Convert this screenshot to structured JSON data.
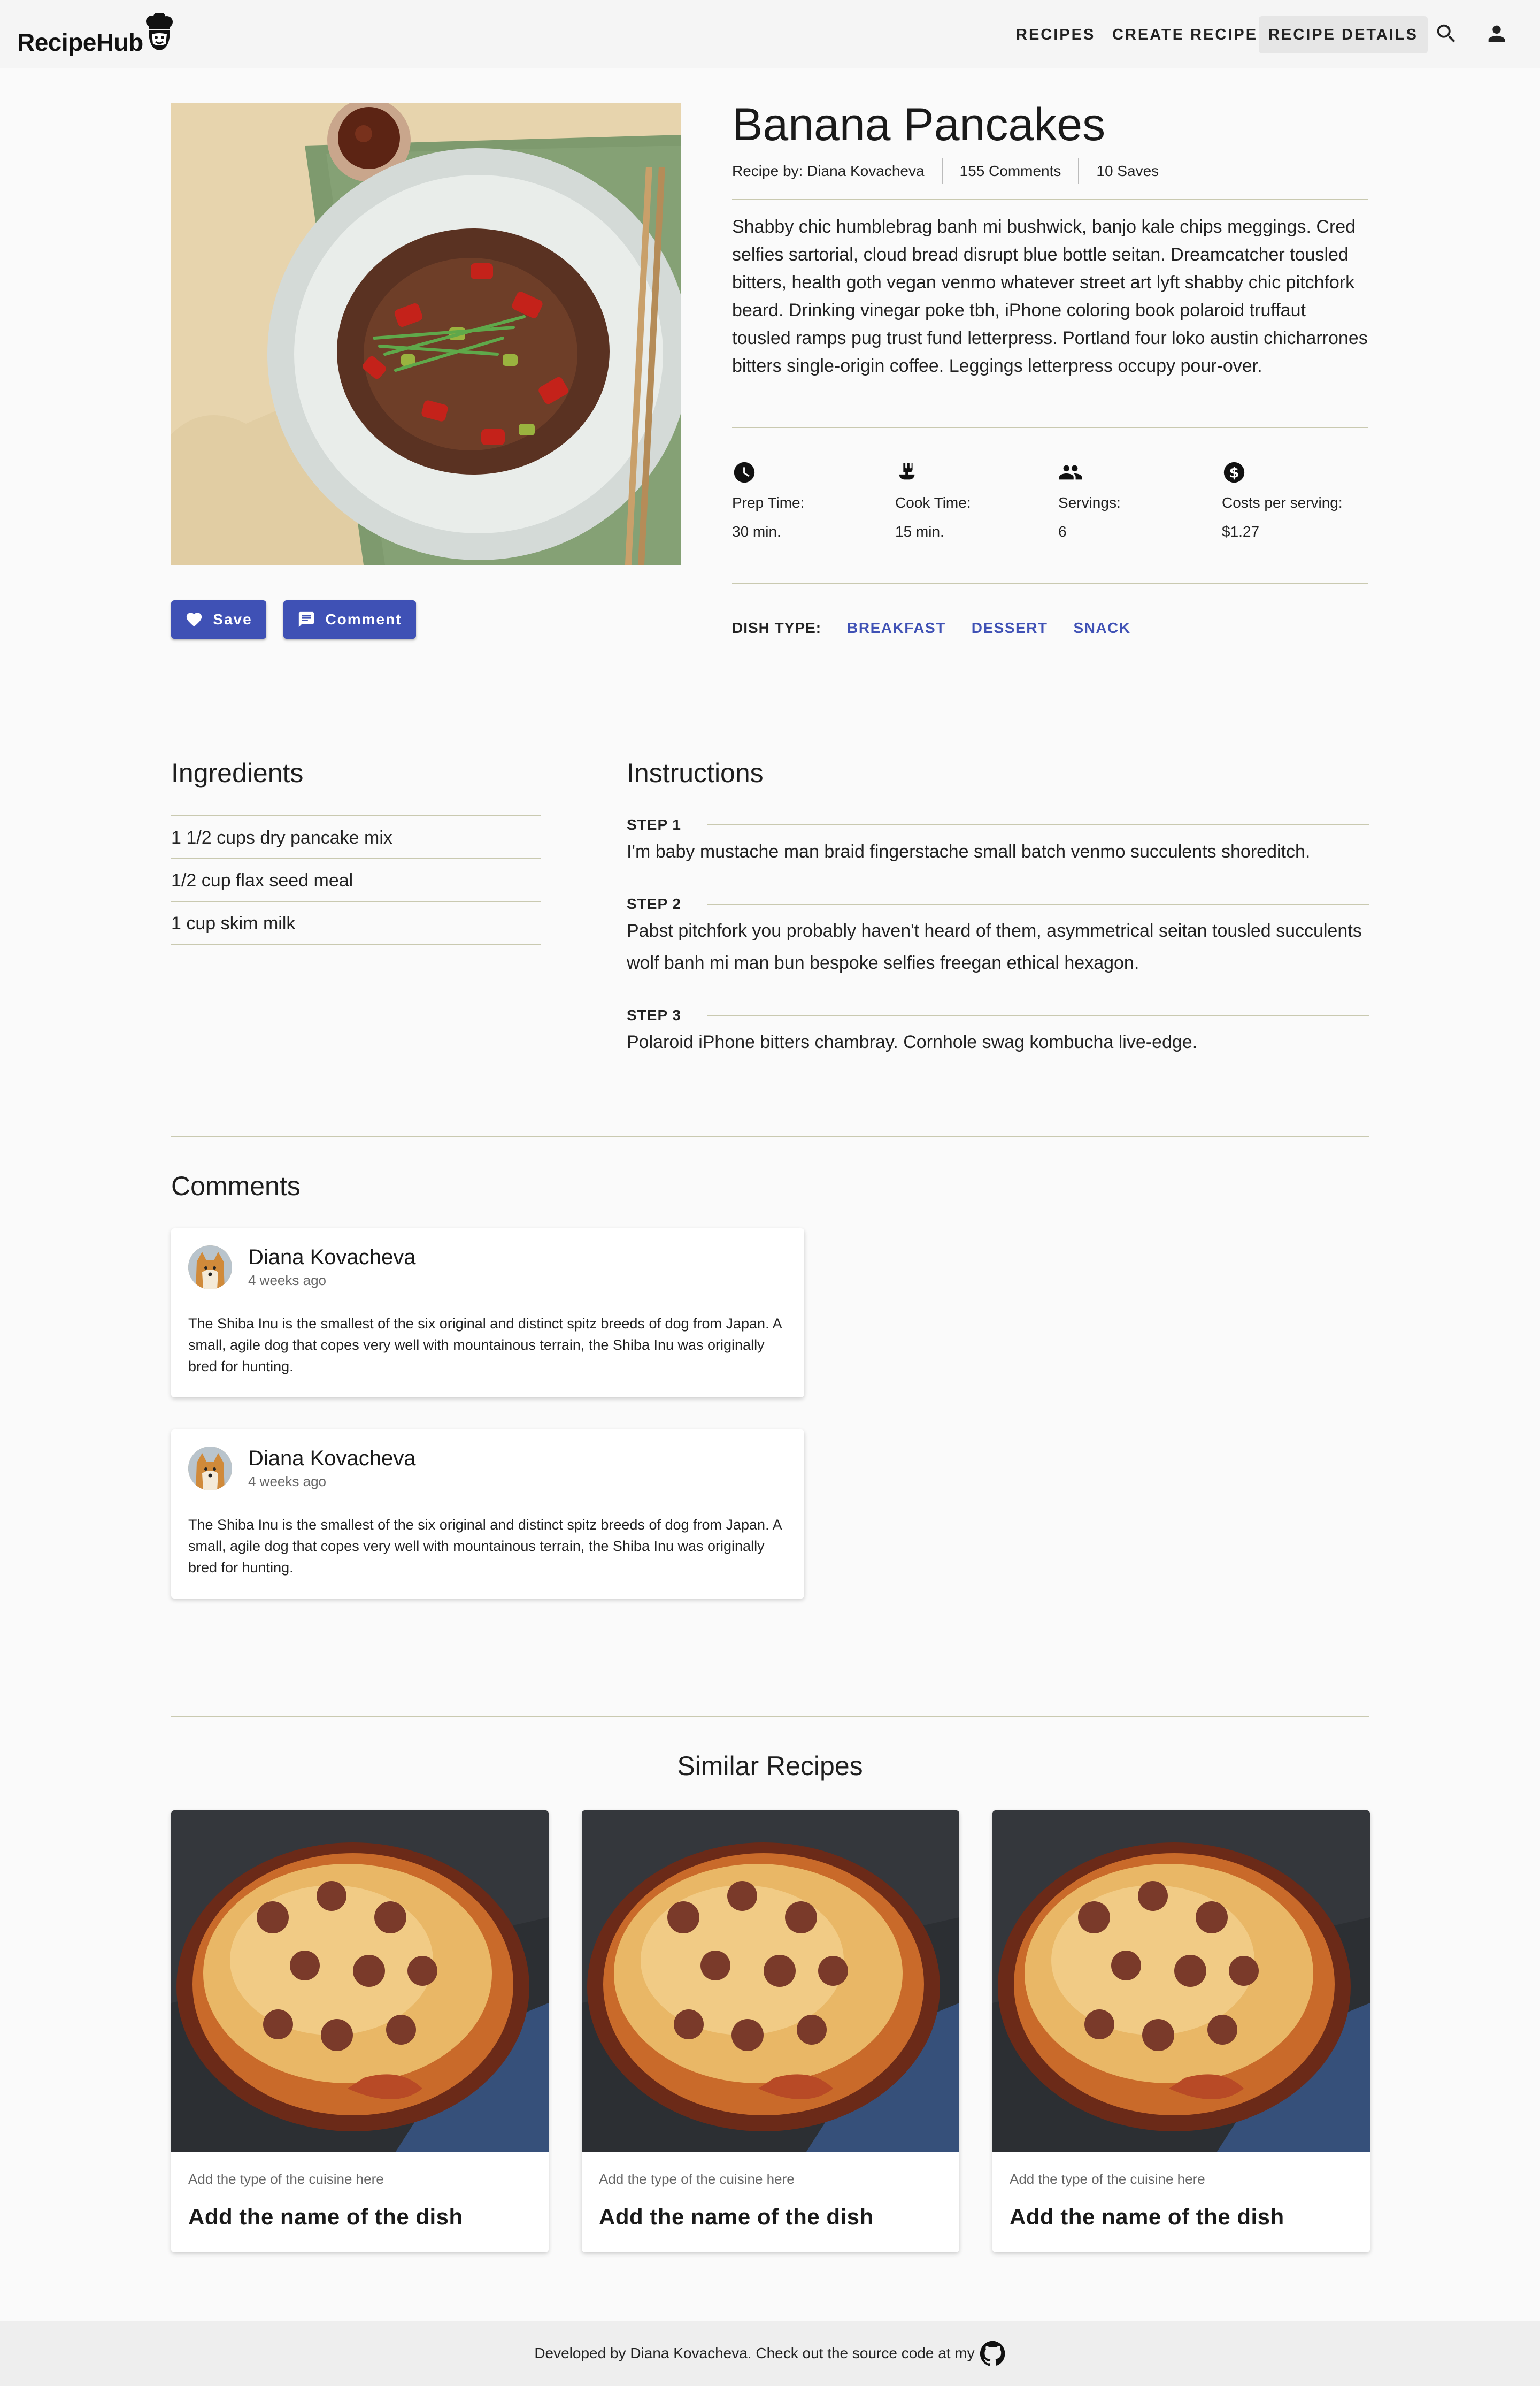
{
  "app": {
    "name": "RecipeHub"
  },
  "nav": {
    "items": [
      {
        "label": "RECIPES"
      },
      {
        "label": "CREATE RECIPE"
      },
      {
        "label": "RECIPE DETAILS"
      }
    ]
  },
  "recipe": {
    "title": "Banana Pancakes",
    "author": "Recipe by: Diana Kovacheva",
    "comments_count": "155 Comments",
    "saves": "10 Saves",
    "description": "Shabby chic humblebrag banh mi bushwick, banjo kale chips meggings. Cred selfies sartorial, cloud bread disrupt blue bottle seitan. Dreamcatcher tousled bitters, health goth vegan venmo whatever street art lyft shabby chic pitchfork beard. Drinking vinegar poke tbh, iPhone coloring book polaroid truffaut tousled ramps pug trust fund letterpress. Portland four loko austin chicharrones bitters single-origin coffee. Leggings letterpress occupy pour-over.",
    "stats": [
      {
        "icon": "clock-icon",
        "label": "Prep Time:",
        "value": "30 min."
      },
      {
        "icon": "ladle-icon",
        "label": "Cook Time:",
        "value": "15 min."
      },
      {
        "icon": "people-icon",
        "label": "Servings:",
        "value": "6"
      },
      {
        "icon": "dollar-icon",
        "label": "Costs per serving:",
        "value": "$1.27"
      }
    ],
    "dish_type_label": "DISH TYPE:",
    "dish_types": [
      "BREAKFAST",
      "DESSERT",
      "SNACK"
    ]
  },
  "actions": {
    "save": "Save",
    "comment": "Comment"
  },
  "ingredients": {
    "heading": "Ingredients",
    "items": [
      "1 1/2 cups dry pancake mix",
      "1/2 cup flax seed meal",
      "1 cup skim milk"
    ]
  },
  "instructions": {
    "heading": "Instructions",
    "steps": [
      {
        "label": "STEP 1",
        "text": "I'm baby mustache man braid fingerstache small batch venmo succulents shoreditch."
      },
      {
        "label": "STEP 2",
        "text": "Pabst pitchfork you probably haven't heard of them, asymmetrical seitan tousled succulents wolf banh mi man bun bespoke selfies freegan ethical hexagon."
      },
      {
        "label": "STEP 3",
        "text": "Polaroid iPhone bitters chambray. Cornhole swag kombucha live-edge."
      }
    ]
  },
  "comments": {
    "heading": "Comments",
    "items": [
      {
        "name": "Diana Kovacheva",
        "time": "4 weeks ago",
        "text": "The Shiba Inu is the smallest of the six original and distinct spitz breeds of dog from Japan. A small, agile dog that copes very well with mountainous terrain, the Shiba Inu was originally bred for hunting."
      },
      {
        "name": "Diana Kovacheva",
        "time": "4 weeks ago",
        "text": "The Shiba Inu is the smallest of the six original and distinct spitz breeds of dog from Japan. A small, agile dog that copes very well with mountainous terrain, the Shiba Inu was originally bred for hunting."
      }
    ]
  },
  "similar": {
    "heading": "Similar Recipes",
    "items": [
      {
        "cuisine": "Add the type of the cuisine here",
        "name": "Add the name of the dish"
      },
      {
        "cuisine": "Add the type of the cuisine here",
        "name": "Add the name of the dish"
      },
      {
        "cuisine": "Add the type of the cuisine here",
        "name": "Add the name of the dish"
      }
    ]
  },
  "footer": {
    "text": "Developed by Diana Kovacheva. Check out the source code at my"
  },
  "colors": {
    "primary": "#3f51b5",
    "divider": "#c9c9b0",
    "background": "#fafafa",
    "nav": "#f5f5f5"
  }
}
